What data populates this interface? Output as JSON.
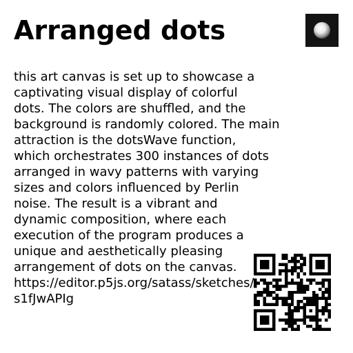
{
  "title": "Arranged dots",
  "description_lines": [
    "this art canvas is set up to showcase a",
    "captivating visual display of colorful",
    "dots. The colors are shuffled, and the",
    "background is randomly colored. The main",
    "attraction is the dotsWave function,",
    "which orchestrates 300 instances of dots",
    "arranged in wavy patterns with varying",
    "sizes and colors influenced by Perlin",
    "noise. The result is a vibrant and",
    "dynamic composition, where each",
    "execution of the program produces a",
    "unique and aesthetically pleasing",
    "arrangement of dots on the canvas.",
    "https://editor.p5js.org/satass/sketches/",
    "s1fJwAPIg"
  ],
  "thumbnail": {
    "background": "#141414",
    "icon": "white-sphere-icon"
  },
  "qr_code": {
    "icon": "qr-code-icon"
  }
}
